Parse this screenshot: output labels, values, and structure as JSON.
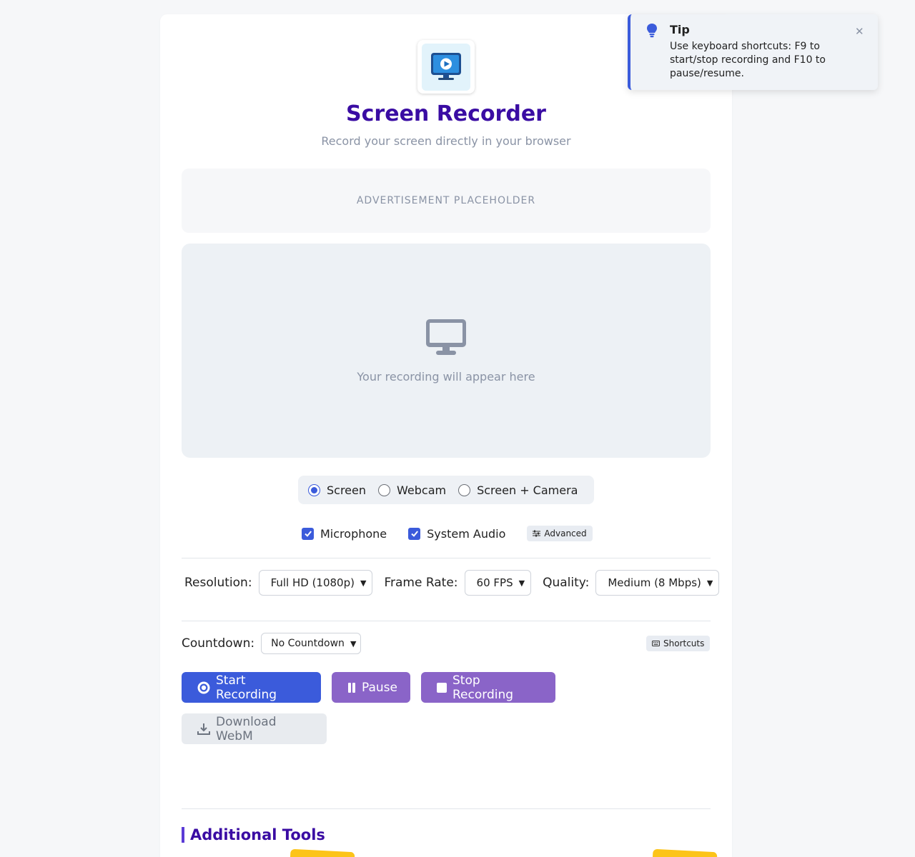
{
  "app": {
    "title": "Screen Recorder",
    "subtitle": "Record your screen directly in your browser",
    "logo_icon": "monitor-play-icon"
  },
  "ad": {
    "text": "ADVERTISEMENT PLACEHOLDER"
  },
  "preview": {
    "icon": "desktop-icon",
    "text": "Your recording will appear here"
  },
  "modes": [
    {
      "label": "Screen",
      "selected": true
    },
    {
      "label": "Webcam",
      "selected": false
    },
    {
      "label": "Screen + Camera",
      "selected": false
    }
  ],
  "audio": {
    "microphone": {
      "label": "Microphone",
      "checked": true
    },
    "system_audio": {
      "label": "System Audio",
      "checked": true
    },
    "advanced_label": "Advanced"
  },
  "settings": {
    "resolution": {
      "label": "Resolution:",
      "value": "Full HD (1080p)"
    },
    "frame_rate": {
      "label": "Frame Rate:",
      "value": "60 FPS"
    },
    "quality": {
      "label": "Quality:",
      "value": "Medium (8 Mbps)"
    }
  },
  "countdown": {
    "label": "Countdown:",
    "value": "No Countdown"
  },
  "shortcuts_label": "Shortcuts",
  "buttons": {
    "start": "Start Recording",
    "pause": "Pause",
    "stop": "Stop Recording",
    "download": "Download WebM"
  },
  "additional_tools": {
    "title": "Additional Tools"
  },
  "toast": {
    "title": "Tip",
    "message": "Use keyboard shortcuts: F9 to start/stop recording and F10 to pause/resume.",
    "icon": "lightbulb-icon"
  },
  "colors": {
    "primary": "#3b5bdb",
    "secondary": "#8a64c8",
    "heading": "#3a0ca3",
    "badge": "#fcc419"
  }
}
